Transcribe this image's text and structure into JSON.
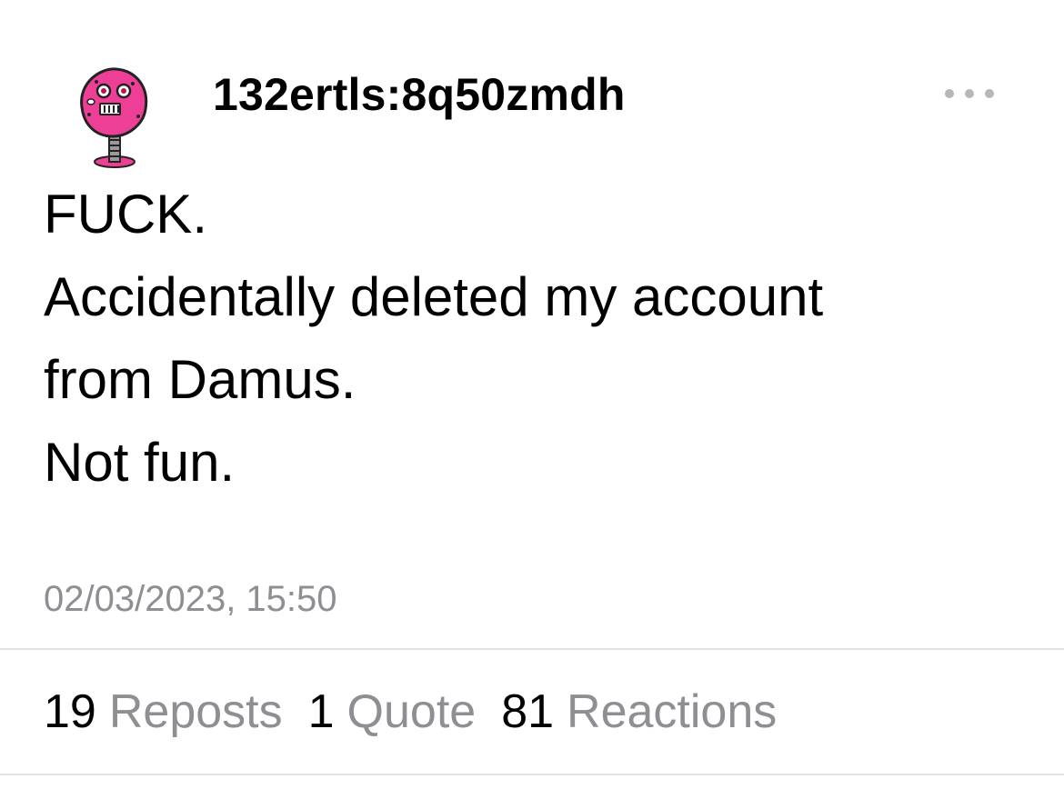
{
  "post": {
    "author": {
      "username": "132ertls:8q50zmdh",
      "avatar_icon": "pink-mushroom-robot-avatar"
    },
    "menu_icon": "more-horizontal-icon",
    "lines": [
      "FUCK.",
      "Accidentally deleted my account",
      "from Damus.",
      "Not fun."
    ],
    "timestamp": "02/03/2023, 15:50"
  },
  "stats": {
    "reposts": {
      "count": "19",
      "label": "Reposts"
    },
    "quotes": {
      "count": "1",
      "label": "Quote"
    },
    "reactions": {
      "count": "81",
      "label": "Reactions"
    }
  },
  "colors": {
    "text_primary": "#000000",
    "text_secondary": "#8e8e93",
    "divider": "#e2e2e4",
    "avatar_pink": "#ee3f97"
  }
}
